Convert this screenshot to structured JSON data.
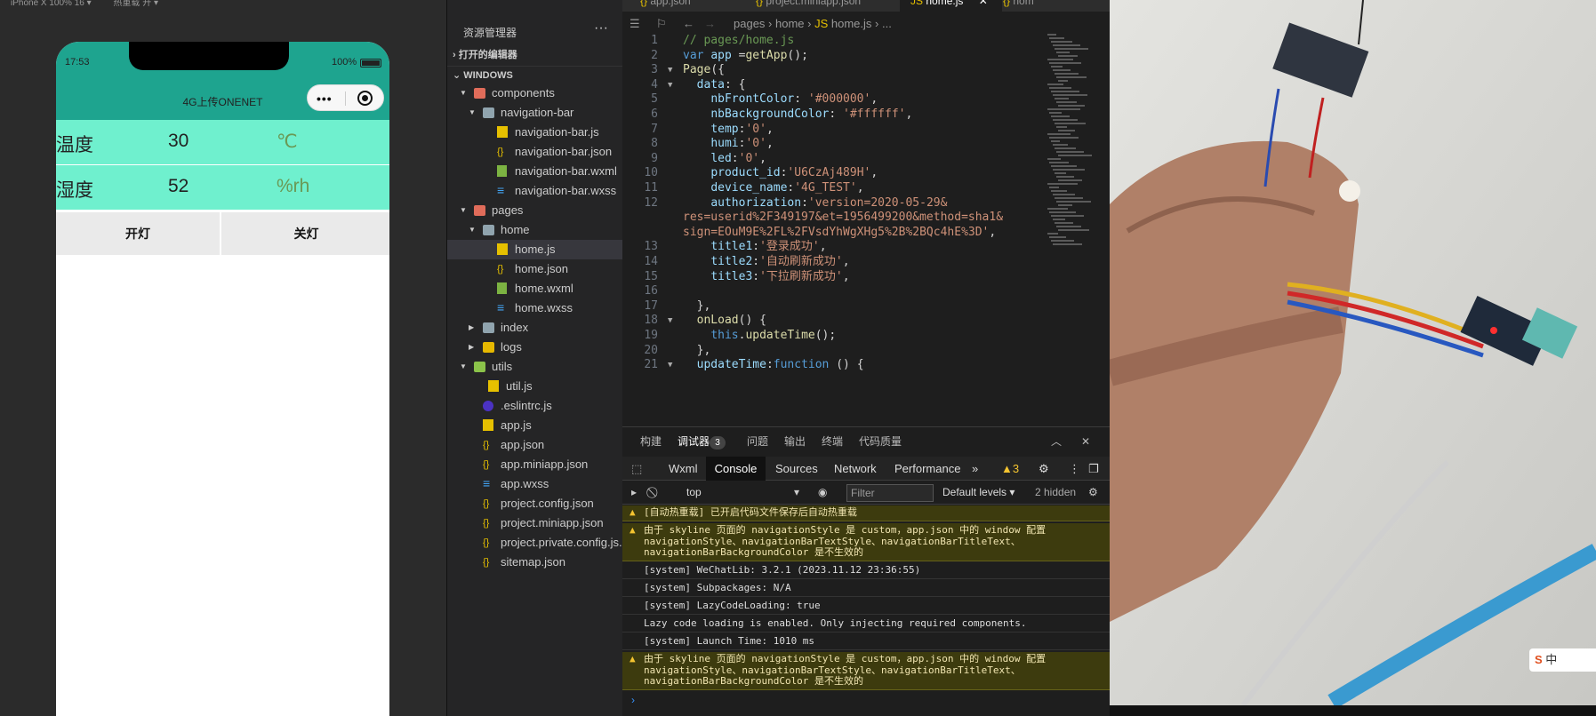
{
  "simulator": {
    "device": "iPhone X 100% 16 ▾",
    "hot_reload": "热重载 开 ▾",
    "status_time": "17:53",
    "battery": "100%",
    "nav_title": "4G上传ONENET",
    "rows": [
      {
        "label": "温度",
        "value": "30",
        "unit": "℃"
      },
      {
        "label": "湿度",
        "value": "52",
        "unit": "%rh"
      }
    ],
    "btn_on": "开灯",
    "btn_off": "关灯"
  },
  "explorer": {
    "title": "资源管理器",
    "more": "···",
    "section_open": "打开的编辑器",
    "section_win": "WINDOWS",
    "tree": [
      "components",
      "navigation-bar",
      "navigation-bar.js",
      "navigation-bar.json",
      "navigation-bar.wxml",
      "navigation-bar.wxss",
      "pages",
      "home",
      "home.js",
      "home.json",
      "home.wxml",
      "home.wxss",
      "index",
      "logs",
      "utils",
      "util.js",
      ".eslintrc.js",
      "app.js",
      "app.json",
      "app.miniapp.json",
      "app.wxss",
      "project.config.json",
      "project.miniapp.json",
      "project.private.config.js...",
      "sitemap.json"
    ]
  },
  "editor": {
    "tabs": [
      "app.json",
      "project.miniapp.json",
      "home.js",
      "hom"
    ],
    "breadcrumb": [
      "pages",
      "home",
      "home.js",
      "..."
    ],
    "line_numbers": [
      "1",
      "2",
      "3",
      "4",
      "5",
      "6",
      "7",
      "8",
      "9",
      "10",
      "11",
      "12",
      "13",
      "14",
      "15",
      "16",
      "17",
      "18",
      "19",
      "20",
      "21"
    ]
  },
  "panel": {
    "tabs": [
      "构建",
      "调试器",
      "问题",
      "输出",
      "终端",
      "代码质量"
    ],
    "badge": "3",
    "devtools_tabs": [
      "Wxml",
      "Console",
      "Sources",
      "Network",
      "Performance",
      "»"
    ],
    "warn_count": "▲3",
    "context": "top",
    "filter_placeholder": "Filter",
    "levels": "Default levels ▾",
    "hidden": "2 hidden",
    "logs": [
      {
        "type": "warn",
        "text": "[自动热重载] 已开启代码文件保存后自动热重载"
      },
      {
        "type": "warn",
        "text": "由于 skyline 页面的 navigationStyle 是 custom，app.json 中的 window 配置\nnavigationStyle、navigationBarTextStyle、navigationBarTitleText、\nnavigationBarBackgroundColor 是不生效的"
      },
      {
        "type": "info",
        "text": "[system] WeChatLib: 3.2.1 (2023.11.12 23:36:55)"
      },
      {
        "type": "info",
        "text": "[system] Subpackages: N/A"
      },
      {
        "type": "info",
        "text": "[system] LazyCodeLoading: true"
      },
      {
        "type": "info",
        "text": "Lazy code loading is enabled. Only injecting required components."
      },
      {
        "type": "info",
        "text": "[system] Launch Time: 1010 ms"
      },
      {
        "type": "warn",
        "text": "由于 skyline 页面的 navigationStyle 是 custom，app.json 中的 window 配置\nnavigationStyle、navigationBarTextStyle、navigationBarTitleText、\nnavigationBarBackgroundColor 是不生效的"
      }
    ],
    "prompt": "›"
  },
  "video": {
    "ime_label": "中"
  },
  "colors": {
    "phone_header": "#1ea48f",
    "row_bg": "#6ff0ce",
    "accent": "#3794ff"
  }
}
